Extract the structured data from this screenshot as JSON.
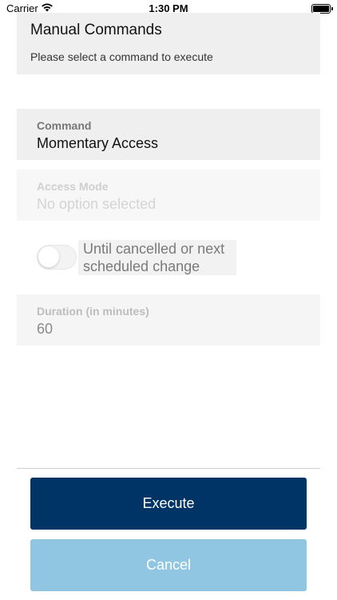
{
  "status_bar": {
    "carrier": "Carrier",
    "time": "1:30 PM"
  },
  "header": {
    "title": "Manual Commands",
    "subtitle": "Please select a command to execute"
  },
  "command_field": {
    "label": "Command",
    "value": "Momentary Access"
  },
  "access_mode_field": {
    "label": "Access Mode",
    "placeholder": "No option selected"
  },
  "until_toggle": {
    "label": "Until cancelled or next scheduled change",
    "on": false
  },
  "duration_field": {
    "label": "Duration (in minutes)",
    "value": "60"
  },
  "buttons": {
    "execute": "Execute",
    "cancel": "Cancel"
  },
  "colors": {
    "execute_bg": "#003366",
    "cancel_bg": "#90c6e2",
    "card_bg": "#efefef"
  }
}
